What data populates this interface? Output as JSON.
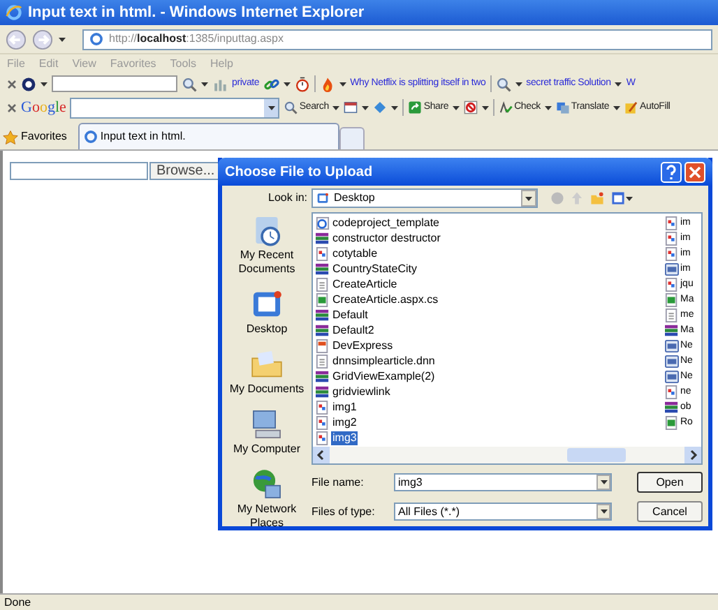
{
  "window": {
    "title": "Input text in html. - Windows Internet Explorer"
  },
  "address_bar": {
    "url": "http://**localhost**:1385/inputtag.aspx"
  },
  "menu": [
    "File",
    "Edit",
    "View",
    "Favorites",
    "Tools",
    "Help"
  ],
  "toolbar": [
    {
      "kind": "close"
    },
    {
      "kind": "icon"
    },
    {
      "kind": "caret"
    },
    {
      "kind": "field"
    },
    {
      "kind": "icon"
    },
    {
      "kind": "caret"
    },
    {
      "kind": "icon"
    },
    {
      "kind": "link",
      "label": "private"
    },
    {
      "kind": "icon"
    },
    {
      "kind": "caret"
    },
    {
      "kind": "icon"
    },
    {
      "kind": "sep"
    },
    {
      "kind": "icon"
    },
    {
      "kind": "caret"
    },
    {
      "kind": "link",
      "label": "Why Netflix is splitting itself in two"
    },
    {
      "kind": "sep"
    },
    {
      "kind": "icon"
    },
    {
      "kind": "caret"
    },
    {
      "kind": "link",
      "label": "secret traffic Solution"
    },
    {
      "kind": "caret"
    },
    {
      "kind": "link",
      "label": "W"
    }
  ],
  "google_toolbar": [
    {
      "kind": "close"
    },
    {
      "kind": "logo",
      "label": "Google"
    },
    {
      "kind": "combo"
    },
    {
      "kind": "button",
      "label": "Search"
    },
    {
      "kind": "caret"
    },
    {
      "kind": "icon"
    },
    {
      "kind": "caret"
    },
    {
      "kind": "icon"
    },
    {
      "kind": "caret"
    },
    {
      "kind": "sep"
    },
    {
      "kind": "button",
      "label": "Share"
    },
    {
      "kind": "caret"
    },
    {
      "kind": "icon"
    },
    {
      "kind": "caret"
    },
    {
      "kind": "sep"
    },
    {
      "kind": "button",
      "label": "Check"
    },
    {
      "kind": "caret"
    },
    {
      "kind": "button",
      "label": "Translate"
    },
    {
      "kind": "caret"
    },
    {
      "kind": "button",
      "label": "AutoFill"
    }
  ],
  "favorites_bar": {
    "label": "Favorites",
    "tabs": [
      {
        "label": "Input text in html.",
        "selected": true
      }
    ]
  },
  "page": {
    "browse_button": "Browse..."
  },
  "dialog": {
    "title": "Choose File to Upload",
    "look_in_label": "Look in:",
    "look_in_value": "Desktop",
    "places": [
      {
        "label": "My Recent Documents",
        "kind": "recent"
      },
      {
        "label": "Desktop",
        "kind": "desktop"
      },
      {
        "label": "My Documents",
        "kind": "documents"
      },
      {
        "label": "My Computer",
        "kind": "computer"
      },
      {
        "label": "My Network Places",
        "kind": "network"
      }
    ],
    "files": [
      {
        "name": "codeproject_template",
        "kind": "web",
        "selected": false
      },
      {
        "name": "constructor destructor",
        "kind": "archive",
        "selected": false
      },
      {
        "name": "cotytable",
        "kind": "image",
        "selected": false
      },
      {
        "name": "CountryStateCity",
        "kind": "archive",
        "selected": false
      },
      {
        "name": "CreateArticle",
        "kind": "page",
        "selected": false
      },
      {
        "name": "CreateArticle.aspx.cs",
        "kind": "code",
        "selected": false
      },
      {
        "name": "Default",
        "kind": "archive",
        "selected": false
      },
      {
        "name": "Default2",
        "kind": "archive",
        "selected": false
      },
      {
        "name": "DevExpress",
        "kind": "app",
        "selected": false
      },
      {
        "name": "dnnsimplearticle.dnn",
        "kind": "page",
        "selected": false
      },
      {
        "name": "GridViewExample(2)",
        "kind": "archive",
        "selected": false
      },
      {
        "name": "gridviewlink",
        "kind": "archive",
        "selected": false
      },
      {
        "name": "img1",
        "kind": "image",
        "selected": false
      },
      {
        "name": "img2",
        "kind": "image",
        "selected": false
      },
      {
        "name": "img3",
        "kind": "image",
        "selected": true
      }
    ],
    "files_column_2": [
      {
        "name": "im",
        "kind": "image"
      },
      {
        "name": "im",
        "kind": "image"
      },
      {
        "name": "im",
        "kind": "image"
      },
      {
        "name": "im",
        "kind": "window"
      },
      {
        "name": "jqu",
        "kind": "image"
      },
      {
        "name": "Ma",
        "kind": "code"
      },
      {
        "name": "me",
        "kind": "page"
      },
      {
        "name": "Ma",
        "kind": "archive"
      },
      {
        "name": "Ne",
        "kind": "window"
      },
      {
        "name": "Ne",
        "kind": "window"
      },
      {
        "name": "Ne",
        "kind": "window"
      },
      {
        "name": "ne",
        "kind": "image"
      },
      {
        "name": "ob",
        "kind": "archive"
      },
      {
        "name": "Ro",
        "kind": "code"
      }
    ],
    "file_name_label": "File name:",
    "file_name_value": "img3",
    "files_of_type_label": "Files of type:",
    "files_of_type_value": "All Files (*.*)",
    "buttons": [
      "Open",
      "Cancel"
    ]
  },
  "status_bar": {
    "text": "Done"
  }
}
